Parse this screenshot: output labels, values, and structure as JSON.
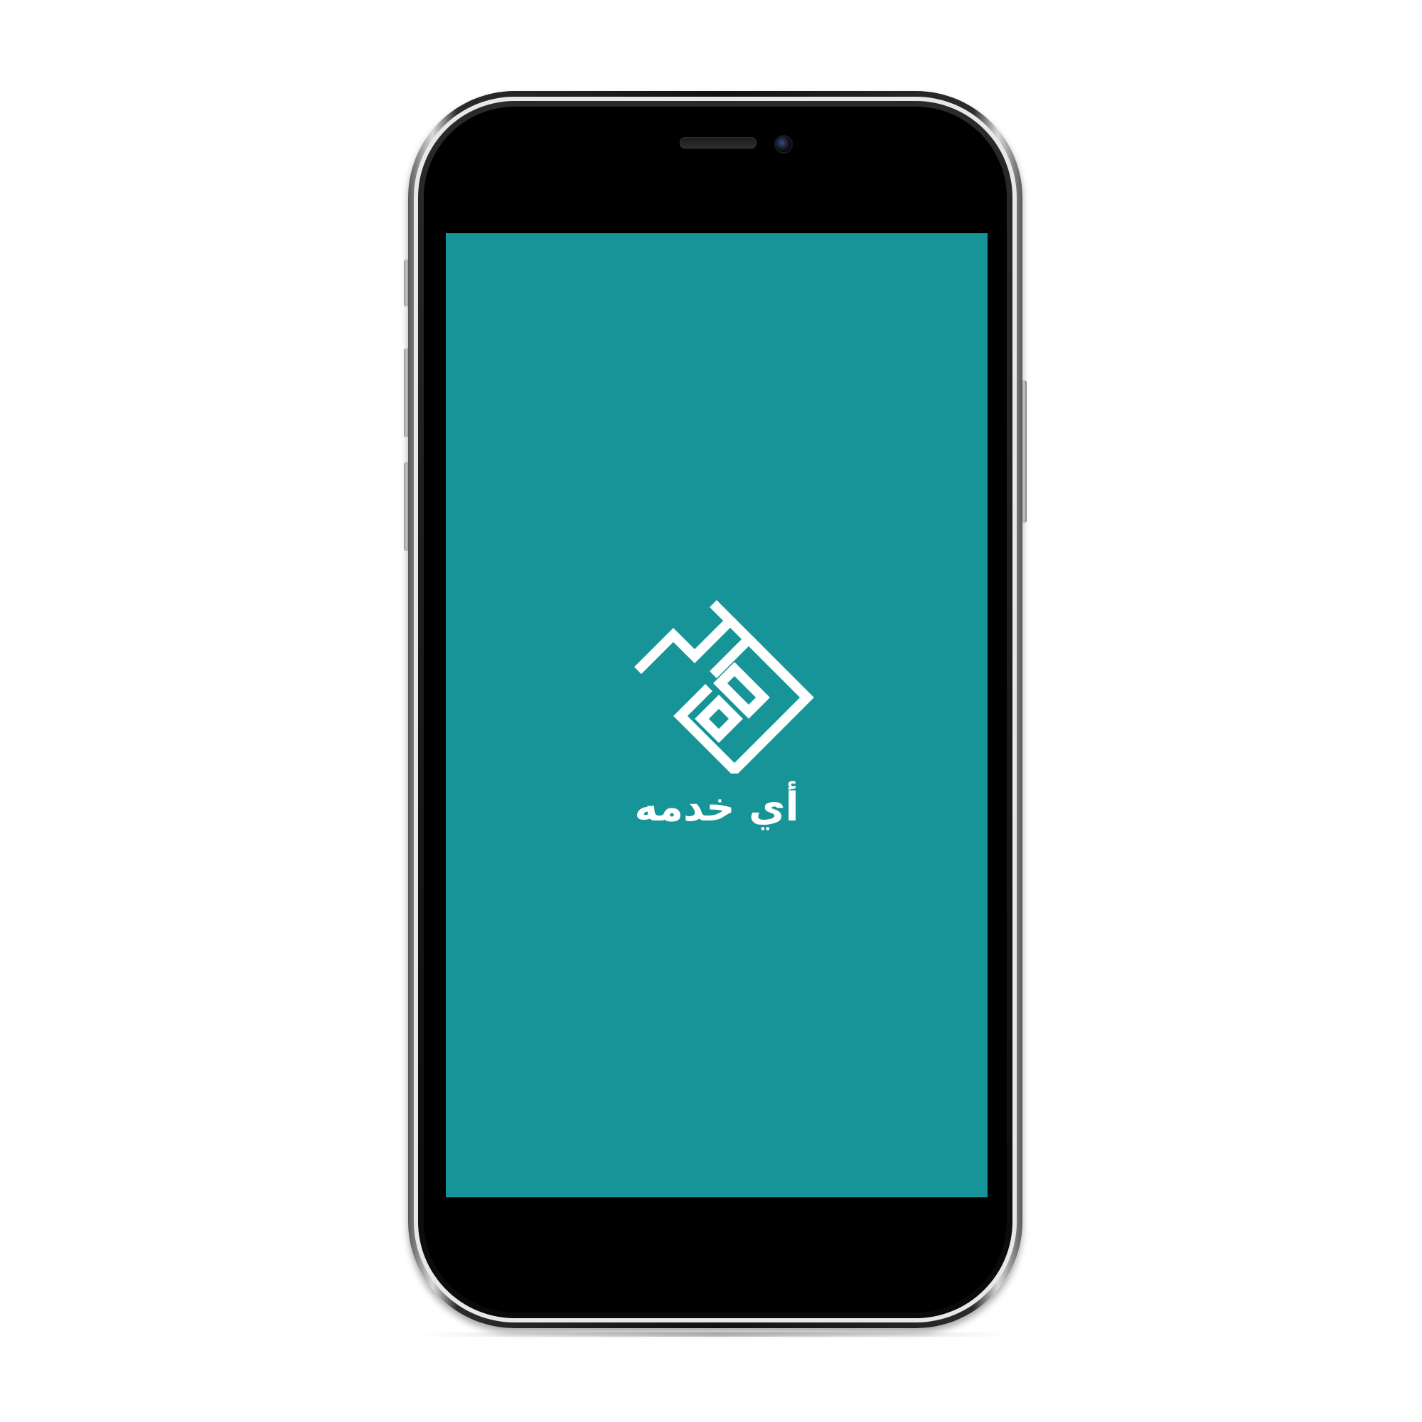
{
  "device": {
    "model_icon": "smartphone-icon"
  },
  "screen": {
    "background_color": "#179497",
    "logo": {
      "icon": "app-logo-icon",
      "color": "#ffffff"
    },
    "app_name": "أي خدمه"
  }
}
